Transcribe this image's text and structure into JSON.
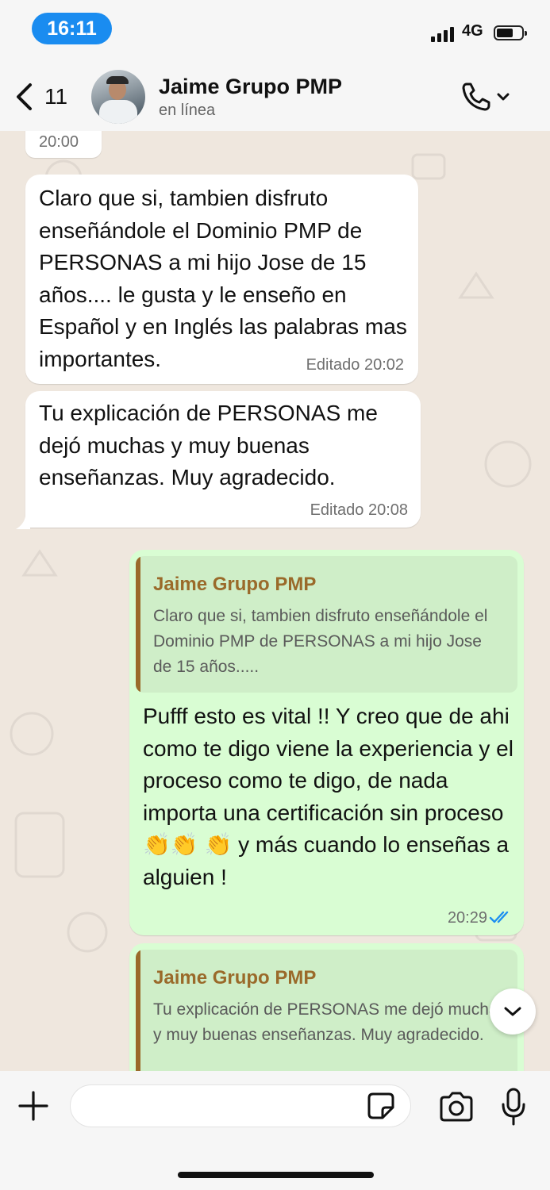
{
  "status_bar": {
    "time": "16:11",
    "network": "4G"
  },
  "header": {
    "back_count": "11",
    "contact_name": "Jaime Grupo PMP",
    "contact_status": "en línea"
  },
  "messages": [
    {
      "type": "incoming",
      "time": "20:00"
    },
    {
      "type": "incoming",
      "text": "Claro que si, tambien disfruto enseñándole el Dominio PMP de PERSONAS a mi hijo Jose de 15 años.... le gusta y le enseño en Español y en Inglés las palabras mas importantes.",
      "meta": "Editado 20:02"
    },
    {
      "type": "incoming",
      "text": "Tu explicación de PERSONAS me dejó muchas y muy buenas enseñanzas. Muy agradecido.",
      "meta": "Editado 20:08"
    },
    {
      "type": "outgoing",
      "quote_name": "Jaime Grupo PMP",
      "quote_text": "Claro que si, tambien disfruto enseñándole el Dominio PMP de PERSONAS a mi hijo Jose de 15 años.....",
      "text": "Pufff esto es vital !! Y creo que de ahi como te digo viene la experiencia y el proceso como te digo, de nada importa una certificación sin proceso 👏👏 👏 y más cuando lo enseñas a alguien !",
      "meta": "20:29",
      "status": "read"
    },
    {
      "type": "outgoing",
      "quote_name": "Jaime Grupo PMP",
      "quote_text": "Tu explicación de PERSONAS me dejó muchas y muy buenas enseñanzas. Muy agradecido."
    }
  ],
  "colors": {
    "read_ticks": "#1d8ff0",
    "quote_accent": "#9a6a2a",
    "outgoing_bubble": "#d9fdd3",
    "chat_bg": "#efe7de"
  },
  "icons": [
    "back-chevron-icon",
    "phone-icon",
    "chevron-down-icon",
    "plus-icon",
    "sticker-icon",
    "camera-icon",
    "mic-icon",
    "double-check-icon",
    "scroll-down-icon"
  ]
}
